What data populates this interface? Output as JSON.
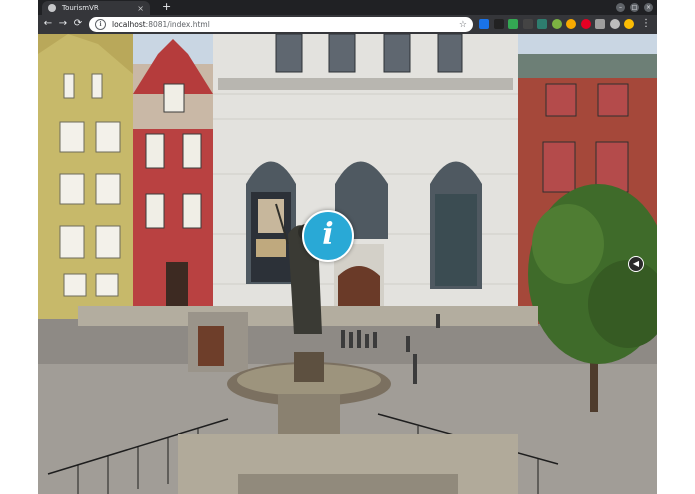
{
  "browser": {
    "tab": {
      "title": "TourismVR",
      "favicon": "globe-icon"
    },
    "new_tab_glyph": "+",
    "window_controls": {
      "minimize": "–",
      "maximize": "□",
      "close": "×"
    },
    "nav": {
      "back": "←",
      "forward": "→",
      "reload": "⟳"
    },
    "address": {
      "host": "localhost",
      "path": ":8081/index.html",
      "info": "i",
      "bookmark": "☆"
    },
    "menu_glyph": "⋮",
    "extensions": [
      {
        "name": "search-ext-icon",
        "color": "#1a73e8"
      },
      {
        "name": "dark-ext-icon",
        "color": "#222222"
      },
      {
        "name": "green-ext-icon",
        "color": "#34a853"
      },
      {
        "name": "mono-ext-icon",
        "color": "#444444"
      },
      {
        "name": "grid-ext-icon",
        "color": "#2e7d6f"
      },
      {
        "name": "circle-ext-icon",
        "color": "#7cb342"
      },
      {
        "name": "moon-ext-icon",
        "color": "#f9ab00"
      },
      {
        "name": "pinterest-ext-icon",
        "color": "#e60023"
      },
      {
        "name": "shield-ext-icon",
        "color": "#9e9e9e"
      },
      {
        "name": "gear-ext-icon",
        "color": "#bdbdbd"
      },
      {
        "name": "profile-ext-icon",
        "color": "#fbbc04"
      }
    ]
  },
  "viewer": {
    "hotspot_glyph": "i",
    "side_button_glyph": "◀",
    "colors": {
      "hotspot": "#29a9d6",
      "sky": "#c9d6e3"
    }
  }
}
